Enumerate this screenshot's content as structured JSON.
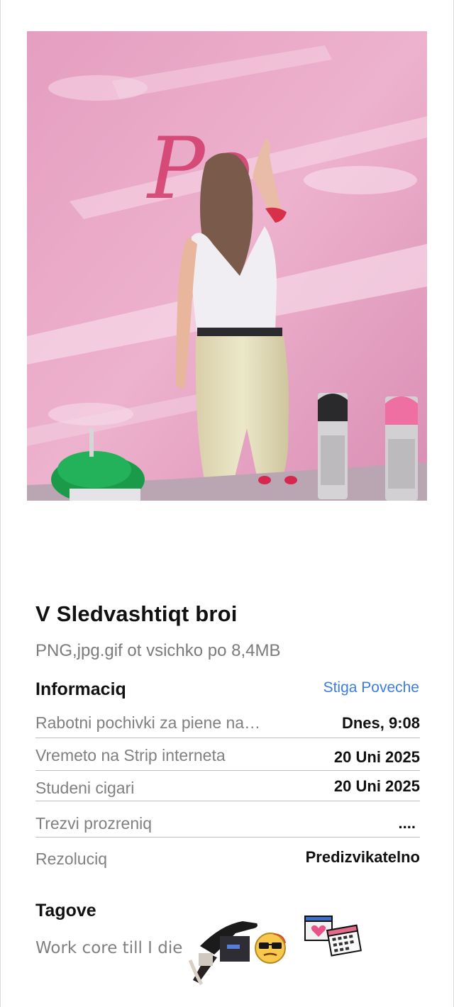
{
  "post": {
    "title": "V Sledvashtiqt broi",
    "subtitle": "PNG,jpg.gif ot vsichko po 8,4MB"
  },
  "photo": {
    "wall_text": "Po"
  },
  "info": {
    "heading": "Informaciq",
    "more_label": "Stiga Poveche",
    "rows": [
      {
        "label": "Rabotni pochivki za piene na…",
        "value": "Dnes, 9:08"
      },
      {
        "label": "Vremeto na Strip interneta",
        "value": "20 Uni 2025"
      },
      {
        "label": "Studeni cigari",
        "value": "20 Uni 2025"
      },
      {
        "label": "Trezvi prozreniq",
        "value": "...."
      },
      {
        "label": "Rezoluciq",
        "value": "Predizvikatelno"
      }
    ]
  },
  "tags": {
    "heading": "Tagove",
    "text": "Work core till I die",
    "stickers": [
      "legs-crate-sticker",
      "sunglasses-smiley-sticker",
      "heart-window-calendar-sticker"
    ]
  }
}
